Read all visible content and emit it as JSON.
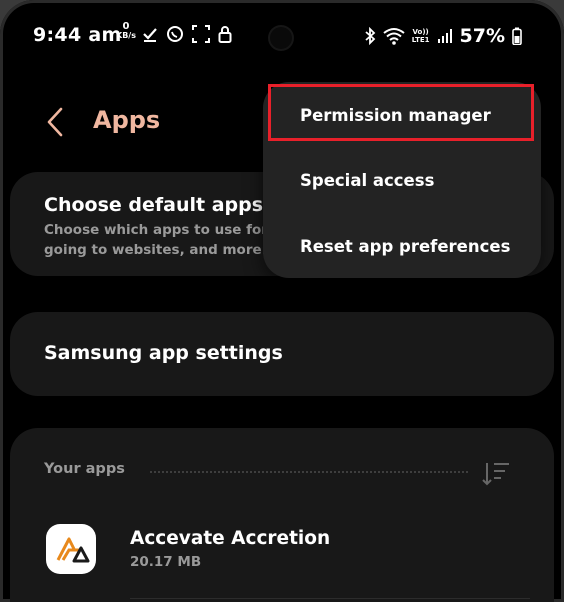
{
  "status_bar": {
    "time": "9:44 am",
    "net_speed_value": "0",
    "net_speed_unit": "KB/s",
    "volte_top": "Vo))",
    "volte_bottom": "LTE1",
    "battery_percent": "57%"
  },
  "header": {
    "title": "Apps"
  },
  "menu": {
    "items": [
      {
        "label": "Permission manager"
      },
      {
        "label": "Special access"
      },
      {
        "label": "Reset app preferences"
      }
    ],
    "highlight_color": "#e8202a"
  },
  "cards": {
    "default_apps": {
      "title": "Choose default apps",
      "desc_line1": "Choose which apps to use for",
      "desc_line2": "going to websites, and more."
    },
    "samsung_settings": {
      "title": "Samsung app settings"
    },
    "your_apps": {
      "header": "Your apps",
      "items": [
        {
          "name": "Accevate Accretion",
          "size": "20.17 MB",
          "icon": "accevate-logo-icon"
        }
      ]
    }
  },
  "colors": {
    "accent": "#f0b7a0",
    "card_bg": "#181818",
    "menu_bg": "#232323"
  }
}
